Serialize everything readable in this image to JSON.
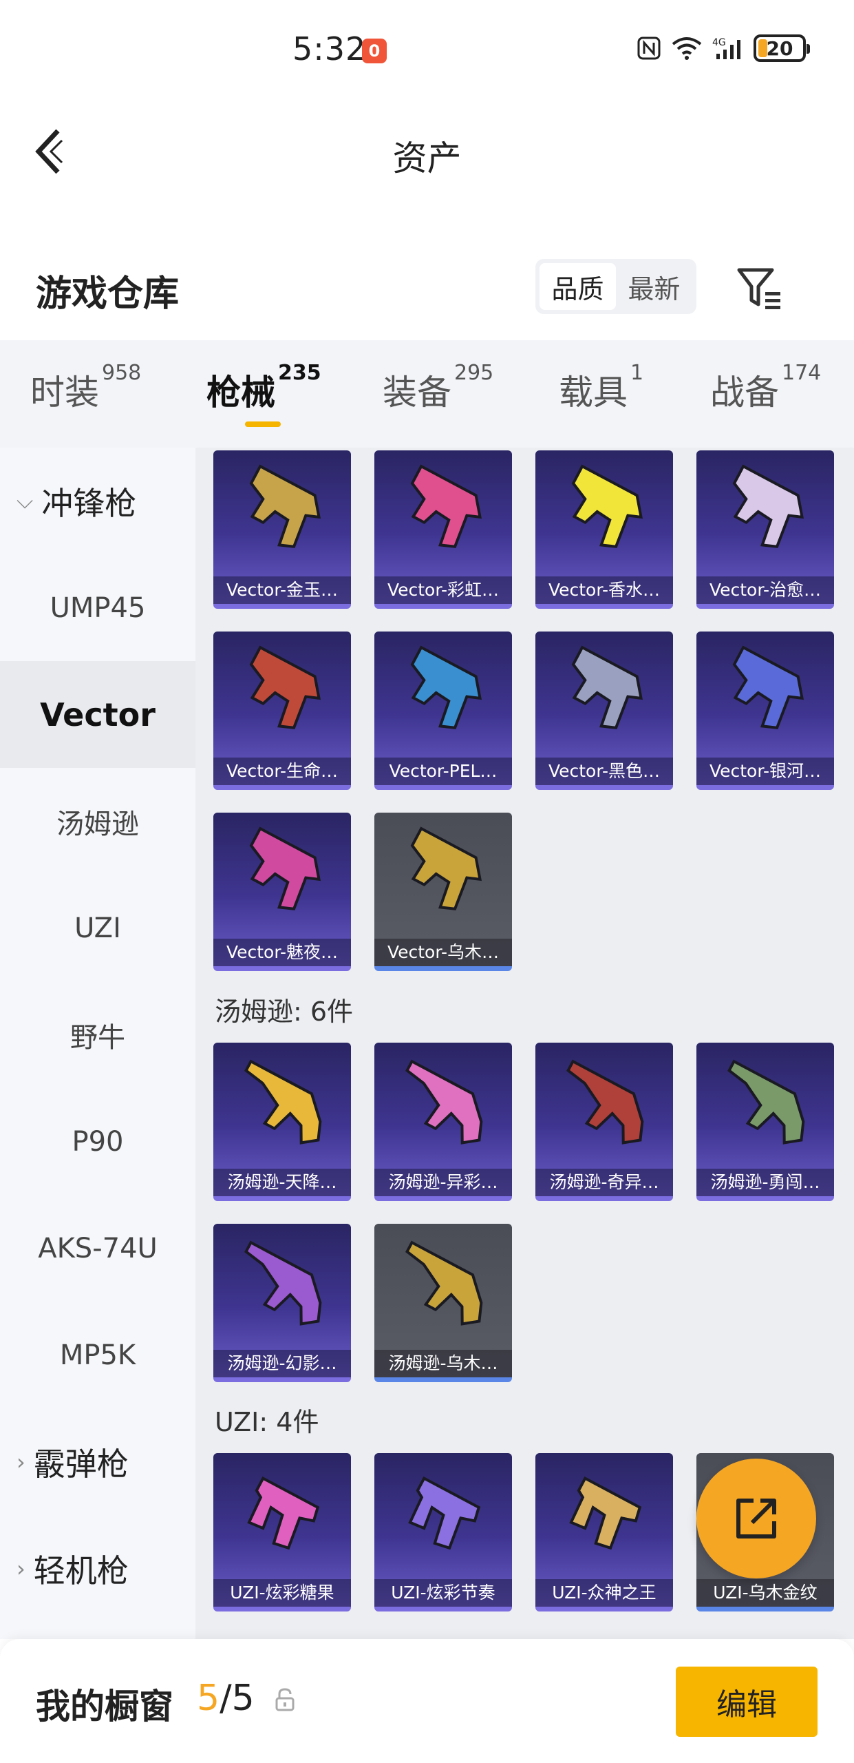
{
  "status": {
    "time": "5:32",
    "notification_badge": "0",
    "network": "4G",
    "battery": "20",
    "battery_level_pct": 20
  },
  "header": {
    "title": "资产"
  },
  "warehouse": {
    "title": "游戏仓库",
    "sort_options": [
      "品质",
      "最新"
    ],
    "active_sort": "品质"
  },
  "tabs": [
    {
      "label": "时装",
      "count": "958"
    },
    {
      "label": "枪械",
      "count": "235",
      "active": true
    },
    {
      "label": "装备",
      "count": "295"
    },
    {
      "label": "载具",
      "count": "1"
    },
    {
      "label": "战备",
      "count": "174"
    }
  ],
  "sidebar": {
    "items": [
      {
        "label": "冲锋枪",
        "type": "group",
        "expanded": true
      },
      {
        "label": "UMP45"
      },
      {
        "label": "Vector",
        "active": true
      },
      {
        "label": "汤姆逊"
      },
      {
        "label": "UZI"
      },
      {
        "label": "野牛"
      },
      {
        "label": "P90"
      },
      {
        "label": "AKS-74U"
      },
      {
        "label": "MP5K"
      },
      {
        "label": "霰弹枪",
        "type": "group",
        "expanded": false
      },
      {
        "label": "轻机枪",
        "type": "group",
        "expanded": false
      }
    ]
  },
  "sections": {
    "vector": {
      "items": [
        {
          "name": "Vector-金玉…",
          "tier": "purple",
          "color": "#c7a34a"
        },
        {
          "name": "Vector-彩虹…",
          "tier": "purple",
          "color": "#e0508f"
        },
        {
          "name": "Vector-香水…",
          "tier": "purple",
          "color": "#f2e53a"
        },
        {
          "name": "Vector-治愈…",
          "tier": "purple",
          "color": "#d9c8e8"
        },
        {
          "name": "Vector-生命…",
          "tier": "purple",
          "color": "#c04a3a"
        },
        {
          "name": "Vector-PEL…",
          "tier": "purple",
          "color": "#3a8fd0"
        },
        {
          "name": "Vector-黑色…",
          "tier": "purple",
          "color": "#9aa0c0"
        },
        {
          "name": "Vector-银河…",
          "tier": "purple",
          "color": "#5a6ad8"
        },
        {
          "name": "Vector-魅夜…",
          "tier": "purple",
          "color": "#d04aa0"
        },
        {
          "name": "Vector-乌木…",
          "tier": "grey",
          "color": "#c9a43a"
        }
      ]
    },
    "thompson": {
      "title": "汤姆逊: 6件",
      "items": [
        {
          "name": "汤姆逊-天降…",
          "tier": "purple",
          "color": "#e8b83a"
        },
        {
          "name": "汤姆逊-异彩…",
          "tier": "purple",
          "color": "#e070c0"
        },
        {
          "name": "汤姆逊-奇异…",
          "tier": "purple",
          "color": "#b0403a"
        },
        {
          "name": "汤姆逊-勇闯…",
          "tier": "purple",
          "color": "#7a9a6a"
        },
        {
          "name": "汤姆逊-幻影…",
          "tier": "purple",
          "color": "#9a5ad0"
        },
        {
          "name": "汤姆逊-乌木…",
          "tier": "grey",
          "color": "#c9a43a"
        }
      ]
    },
    "uzi": {
      "title": "UZI: 4件",
      "items": [
        {
          "name": "UZI-炫彩糖果",
          "tier": "purple",
          "color": "#e060c0"
        },
        {
          "name": "UZI-炫彩节奏",
          "tier": "purple",
          "color": "#8a70e0"
        },
        {
          "name": "UZI-众神之王",
          "tier": "purple",
          "color": "#d9b060"
        },
        {
          "name": "UZI-乌木金纹",
          "tier": "grey",
          "color": "#c9a43a"
        }
      ]
    }
  },
  "bottom": {
    "title": "我的橱窗",
    "count_current": "5",
    "count_sep": "/",
    "count_total": "5",
    "edit_label": "编辑"
  },
  "colors": {
    "accent": "#f5b400",
    "card_purple": "#3f3591",
    "card_grey": "#54565f"
  }
}
